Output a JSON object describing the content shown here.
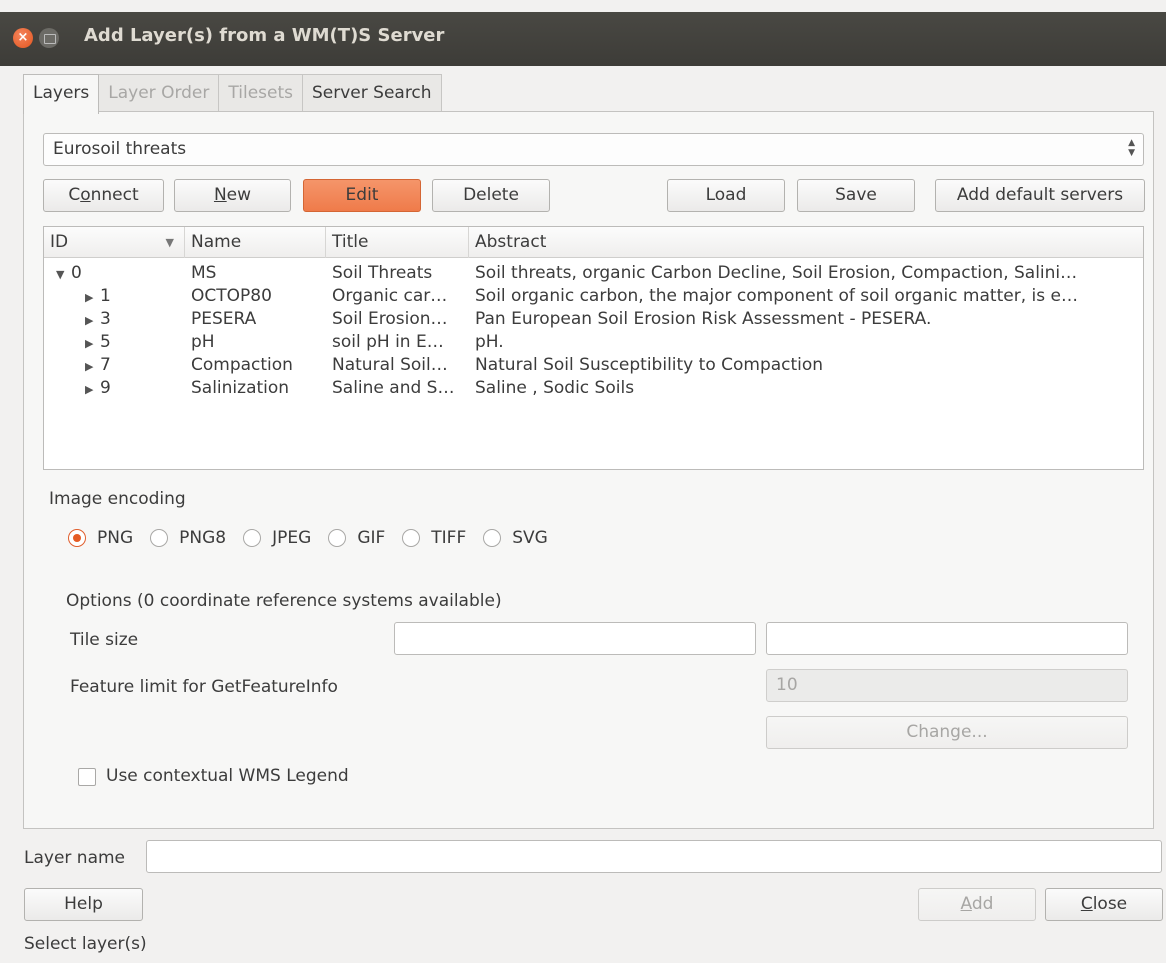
{
  "window": {
    "title": "Add Layer(s) from a WM(T)S Server"
  },
  "tabs": [
    {
      "label": "Layers",
      "state": "active"
    },
    {
      "label": "Layer Order",
      "state": "disabled"
    },
    {
      "label": "Tilesets",
      "state": "disabled"
    },
    {
      "label": "Server Search",
      "state": "enabled"
    }
  ],
  "connection": {
    "selected": "Eurosoil threats"
  },
  "buttons": {
    "connect": "Connect",
    "new": "New",
    "edit": "Edit",
    "delete": "Delete",
    "load": "Load",
    "save": "Save",
    "add_default": "Add default servers"
  },
  "layer_table": {
    "columns": [
      "ID",
      "Name",
      "Title",
      "Abstract"
    ],
    "rows": [
      {
        "id": "0",
        "name": "MS",
        "title": "Soil Threats",
        "abstract": "Soil threats, organic Carbon Decline, Soil Erosion, Compaction, Salini…"
      },
      {
        "id": "1",
        "name": "OCTOP80",
        "title": "Organic car…",
        "abstract": "Soil organic carbon, the major component of soil organic matter, is e…"
      },
      {
        "id": "3",
        "name": "PESERA",
        "title": "Soil Erosion…",
        "abstract": "Pan European Soil Erosion Risk Assessment - PESERA."
      },
      {
        "id": "5",
        "name": "pH",
        "title": "soil pH in E…",
        "abstract": "pH."
      },
      {
        "id": "7",
        "name": "Compaction",
        "title": "Natural Soil…",
        "abstract": "Natural Soil Susceptibility to Compaction"
      },
      {
        "id": "9",
        "name": "Salinization",
        "title": "Saline and S…",
        "abstract": "Saline , Sodic Soils"
      }
    ]
  },
  "image_encoding": {
    "label": "Image encoding",
    "options": [
      "PNG",
      "PNG8",
      "JPEG",
      "GIF",
      "TIFF",
      "SVG"
    ],
    "selected": "PNG"
  },
  "options": {
    "heading": "Options (0 coordinate reference systems available)",
    "tile_size_label": "Tile size",
    "tile_width": "",
    "tile_height": "",
    "feature_limit_label": "Feature limit for GetFeatureInfo",
    "feature_limit": "10",
    "change_button": "Change...",
    "contextual_legend_label": "Use contextual WMS Legend",
    "contextual_legend_checked": false
  },
  "layer_name": {
    "label": "Layer name",
    "value": ""
  },
  "footer": {
    "help": "Help",
    "add": "Add",
    "close": "Close",
    "status": "Select layer(s)"
  },
  "colors": {
    "accent": "#ef7b4a",
    "titlebar": "#3d3c38",
    "radio_selected": "#e55b24"
  }
}
